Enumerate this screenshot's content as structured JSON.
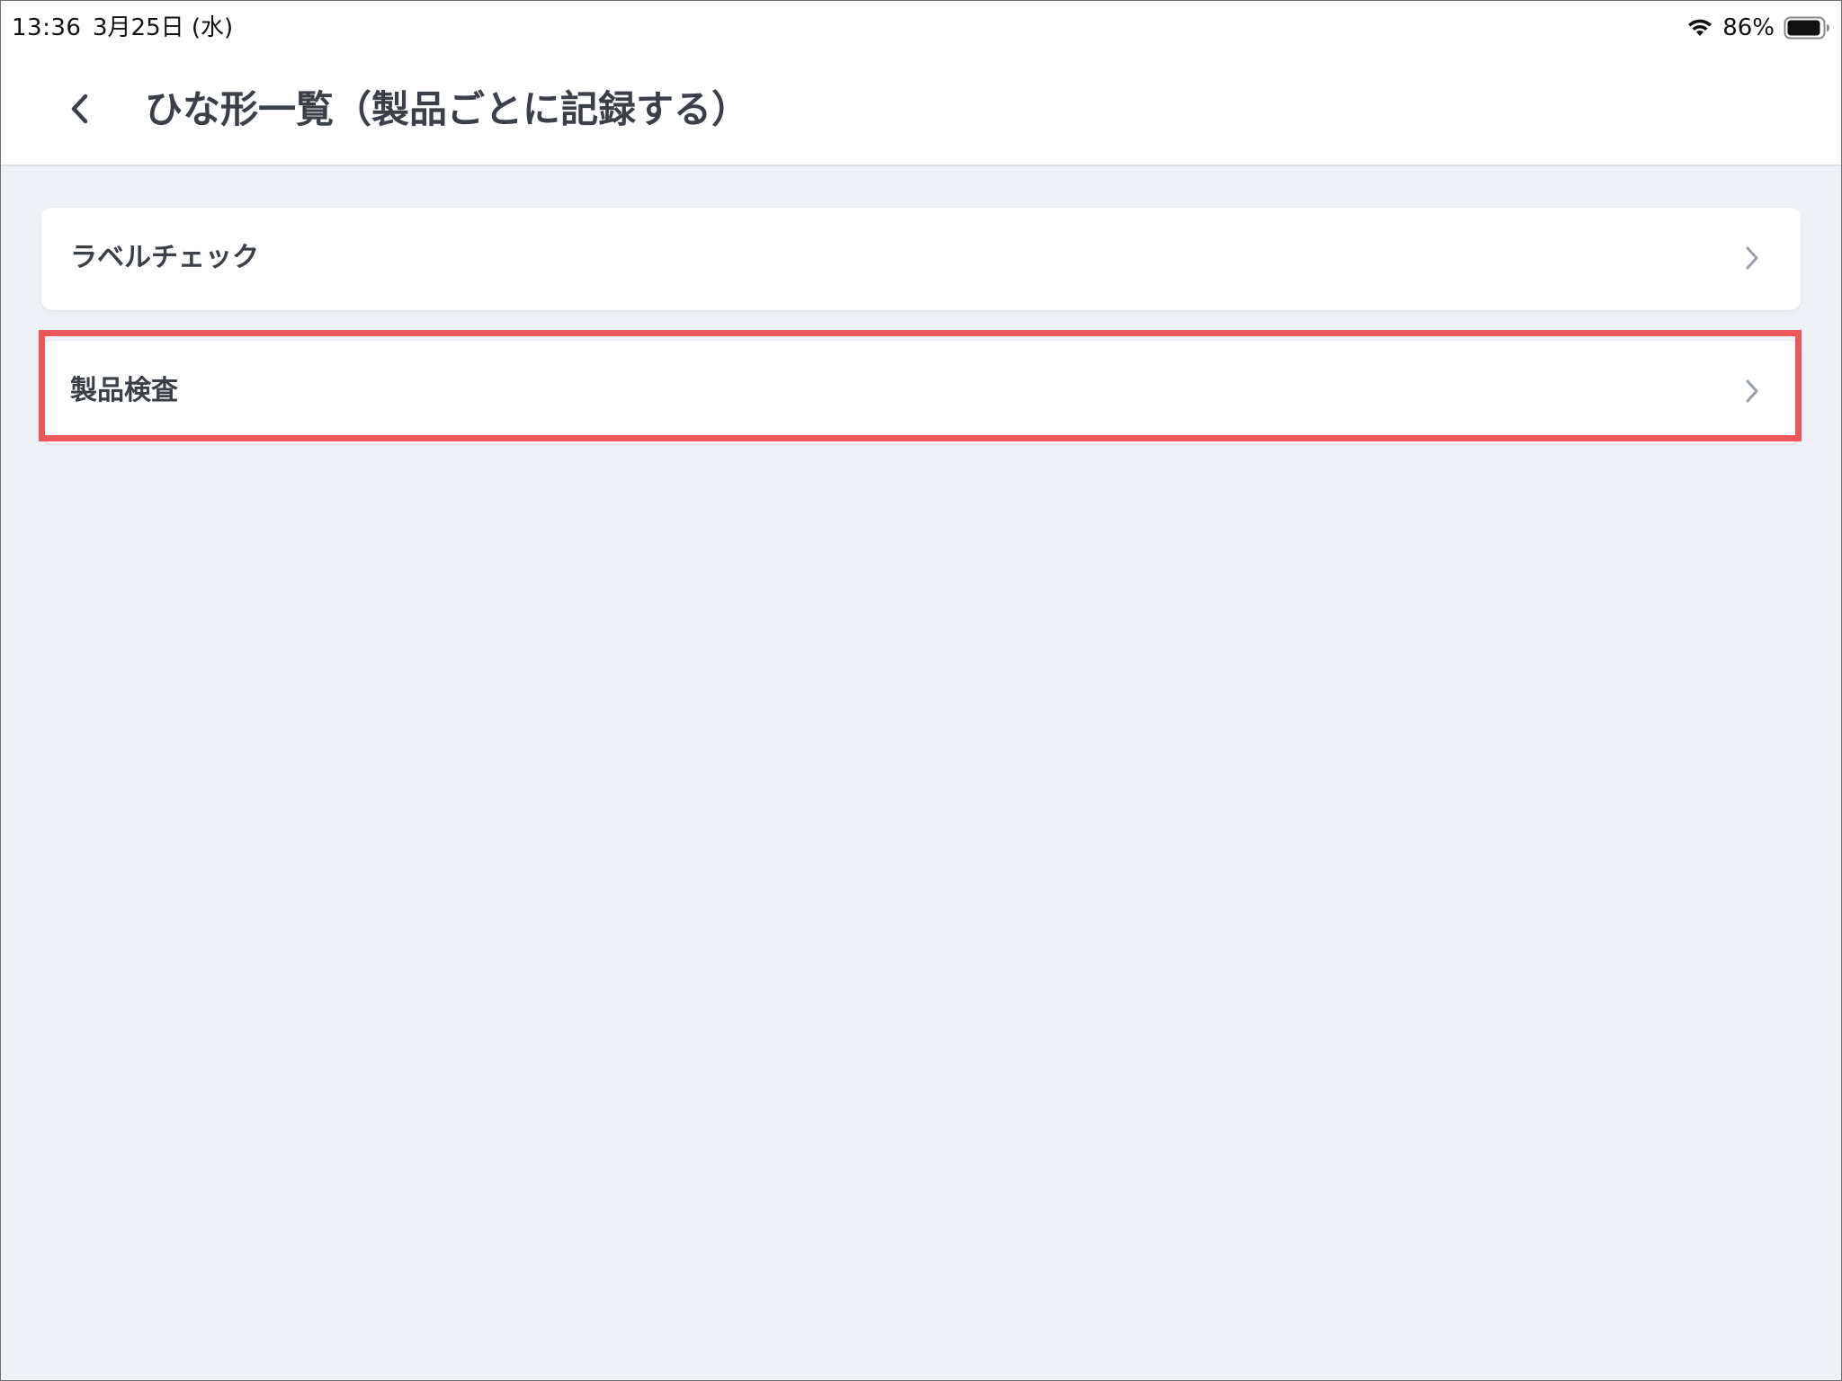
{
  "status_bar": {
    "time": "13:36",
    "date": "3月25日 (水)",
    "battery_percent": "86%",
    "icons": [
      "wifi-icon",
      "battery-icon"
    ]
  },
  "header": {
    "back_icon": "chevron-left-icon",
    "title": "ひな形一覧（製品ごとに記録する）"
  },
  "list": {
    "items": [
      {
        "label": "ラベルチェック",
        "icon": "chevron-right-icon"
      },
      {
        "label": "製品検査",
        "icon": "chevron-right-icon",
        "highlighted": true
      }
    ]
  },
  "colors": {
    "background": "#eef1f6",
    "surface": "#ffffff",
    "text": "#3b4048",
    "chevron": "#9aa0a8",
    "highlight": "#f0575c"
  }
}
